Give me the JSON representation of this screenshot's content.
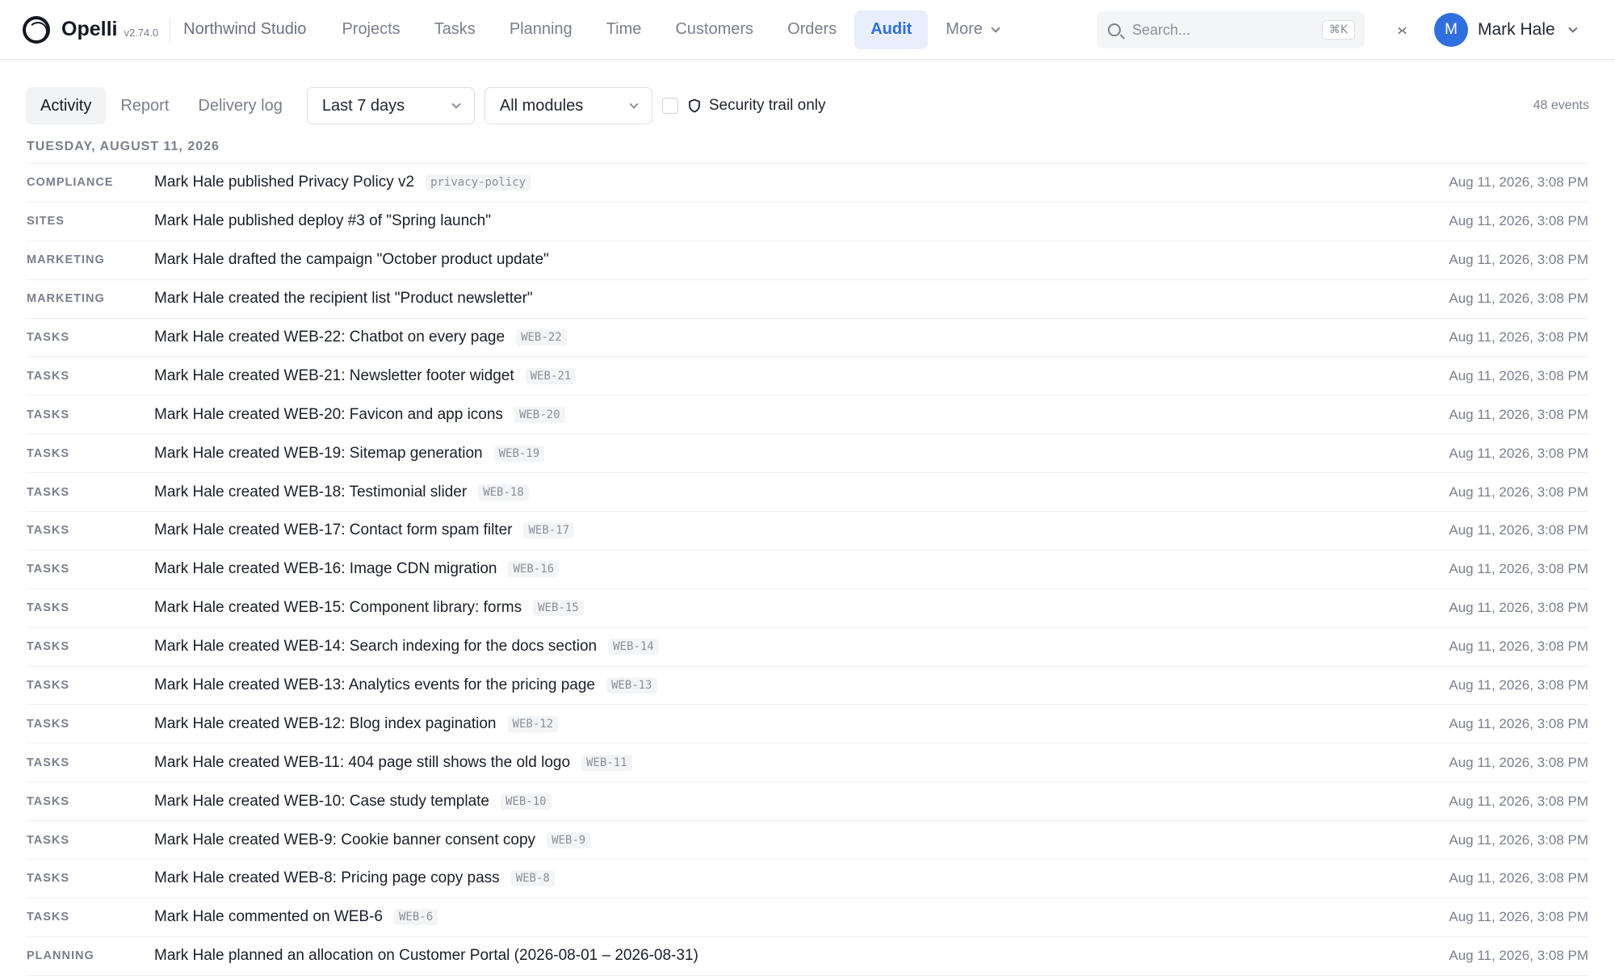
{
  "header": {
    "brand": "Opelli",
    "version": "v2.74.0",
    "workspace": "Northwind Studio",
    "nav": [
      {
        "label": "Projects",
        "active": false
      },
      {
        "label": "Tasks",
        "active": false
      },
      {
        "label": "Planning",
        "active": false
      },
      {
        "label": "Time",
        "active": false
      },
      {
        "label": "Customers",
        "active": false
      },
      {
        "label": "Orders",
        "active": false
      },
      {
        "label": "Audit",
        "active": true
      }
    ],
    "more_label": "More",
    "search": {
      "placeholder": "Search...",
      "shortcut": "⌘K"
    },
    "user": {
      "initial": "M",
      "name": "Mark Hale"
    }
  },
  "toolbar": {
    "tabs": [
      "Activity",
      "Report",
      "Delivery log"
    ],
    "active_tab": "Activity",
    "range_select": "Last 7 days",
    "module_select": "All modules",
    "security_label": "Security trail only",
    "events_count": "48 events"
  },
  "date_header": "TUESDAY, AUGUST 11, 2026",
  "rows": [
    {
      "module": "COMPLIANCE",
      "text": "Mark Hale published Privacy Policy v2",
      "tag": "privacy-policy",
      "time": "Aug 11, 2026, 3:08 PM"
    },
    {
      "module": "SITES",
      "text": "Mark Hale published deploy #3 of \"Spring launch\"",
      "tag": "",
      "time": "Aug 11, 2026, 3:08 PM"
    },
    {
      "module": "MARKETING",
      "text": "Mark Hale drafted the campaign \"October product update\"",
      "tag": "",
      "time": "Aug 11, 2026, 3:08 PM"
    },
    {
      "module": "MARKETING",
      "text": "Mark Hale created the recipient list \"Product newsletter\"",
      "tag": "",
      "time": "Aug 11, 2026, 3:08 PM"
    },
    {
      "module": "TASKS",
      "text": "Mark Hale created WEB-22: Chatbot on every page",
      "tag": "WEB-22",
      "time": "Aug 11, 2026, 3:08 PM"
    },
    {
      "module": "TASKS",
      "text": "Mark Hale created WEB-21: Newsletter footer widget",
      "tag": "WEB-21",
      "time": "Aug 11, 2026, 3:08 PM"
    },
    {
      "module": "TASKS",
      "text": "Mark Hale created WEB-20: Favicon and app icons",
      "tag": "WEB-20",
      "time": "Aug 11, 2026, 3:08 PM"
    },
    {
      "module": "TASKS",
      "text": "Mark Hale created WEB-19: Sitemap generation",
      "tag": "WEB-19",
      "time": "Aug 11, 2026, 3:08 PM"
    },
    {
      "module": "TASKS",
      "text": "Mark Hale created WEB-18: Testimonial slider",
      "tag": "WEB-18",
      "time": "Aug 11, 2026, 3:08 PM"
    },
    {
      "module": "TASKS",
      "text": "Mark Hale created WEB-17: Contact form spam filter",
      "tag": "WEB-17",
      "time": "Aug 11, 2026, 3:08 PM"
    },
    {
      "module": "TASKS",
      "text": "Mark Hale created WEB-16: Image CDN migration",
      "tag": "WEB-16",
      "time": "Aug 11, 2026, 3:08 PM"
    },
    {
      "module": "TASKS",
      "text": "Mark Hale created WEB-15: Component library: forms",
      "tag": "WEB-15",
      "time": "Aug 11, 2026, 3:08 PM"
    },
    {
      "module": "TASKS",
      "text": "Mark Hale created WEB-14: Search indexing for the docs section",
      "tag": "WEB-14",
      "time": "Aug 11, 2026, 3:08 PM"
    },
    {
      "module": "TASKS",
      "text": "Mark Hale created WEB-13: Analytics events for the pricing page",
      "tag": "WEB-13",
      "time": "Aug 11, 2026, 3:08 PM"
    },
    {
      "module": "TASKS",
      "text": "Mark Hale created WEB-12: Blog index pagination",
      "tag": "WEB-12",
      "time": "Aug 11, 2026, 3:08 PM"
    },
    {
      "module": "TASKS",
      "text": "Mark Hale created WEB-11: 404 page still shows the old logo",
      "tag": "WEB-11",
      "time": "Aug 11, 2026, 3:08 PM"
    },
    {
      "module": "TASKS",
      "text": "Mark Hale created WEB-10: Case study template",
      "tag": "WEB-10",
      "time": "Aug 11, 2026, 3:08 PM"
    },
    {
      "module": "TASKS",
      "text": "Mark Hale created WEB-9: Cookie banner consent copy",
      "tag": "WEB-9",
      "time": "Aug 11, 2026, 3:08 PM"
    },
    {
      "module": "TASKS",
      "text": "Mark Hale created WEB-8: Pricing page copy pass",
      "tag": "WEB-8",
      "time": "Aug 11, 2026, 3:08 PM"
    },
    {
      "module": "TASKS",
      "text": "Mark Hale commented on WEB-6",
      "tag": "WEB-6",
      "time": "Aug 11, 2026, 3:08 PM"
    },
    {
      "module": "PLANNING",
      "text": "Mark Hale planned an allocation on Customer Portal (2026-08-01 – 2026-08-31)",
      "tag": "",
      "time": "Aug 11, 2026, 3:08 PM"
    }
  ],
  "colors": {
    "accent": "#2f6fe0",
    "active_nav_bg": "#e8eefb",
    "muted": "#7a7f8c"
  },
  "icons": {
    "search": "search-icon",
    "collapse": "collapse-icon",
    "shield": "shield-icon",
    "chevron": "chevron-down-icon"
  }
}
